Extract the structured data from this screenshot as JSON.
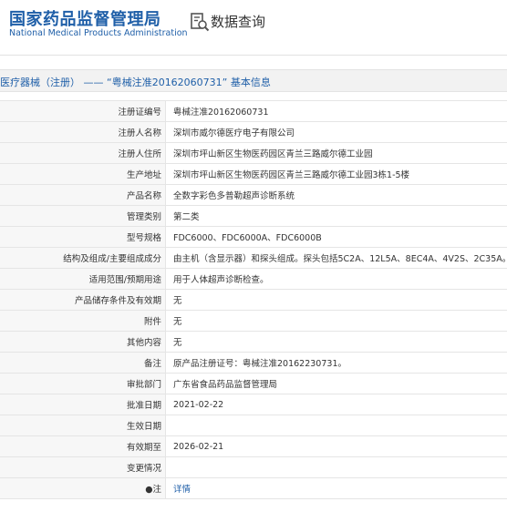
{
  "header": {
    "logo_title": "国家药品监督管理局",
    "logo_subtitle": "National Medical Products Administration",
    "query_icon": "search-document-icon",
    "query_title": "数据查询"
  },
  "section": {
    "title": "医疗器械（注册） —— “粤械注准20162060731” 基本信息"
  },
  "rows": [
    {
      "label": "注册证编号",
      "value": "粤械注准20162060731"
    },
    {
      "label": "注册人名称",
      "value": "深圳市威尔德医疗电子有限公司"
    },
    {
      "label": "注册人住所",
      "value": "深圳市坪山新区生物医药园区青兰三路威尔德工业园"
    },
    {
      "label": "生产地址",
      "value": "深圳市坪山新区生物医药园区青兰三路威尔德工业园3栋1-5楼"
    },
    {
      "label": "产品名称",
      "value": "全数字彩色多普勒超声诊断系统"
    },
    {
      "label": "管理类别",
      "value": "第二类"
    },
    {
      "label": "型号规格",
      "value": "FDC6000、FDC6000A、FDC6000B"
    },
    {
      "label": "结构及组成/主要组成成分",
      "value": "由主机（含显示器）和探头组成。探头包括5C2A、12L5A、8EC4A、4V2S、2C35A。"
    },
    {
      "label": "适用范围/预期用途",
      "value": "用于人体超声诊断检查。"
    },
    {
      "label": "产品储存条件及有效期",
      "value": "无"
    },
    {
      "label": "附件",
      "value": "无"
    },
    {
      "label": "其他内容",
      "value": "无"
    },
    {
      "label": "备注",
      "value": "原产品注册证号：粤械注准20162230731。"
    },
    {
      "label": "审批部门",
      "value": "广东省食品药品监督管理局"
    },
    {
      "label": "批准日期",
      "value": "2021-02-22"
    },
    {
      "label": "生效日期",
      "value": ""
    },
    {
      "label": "有效期至",
      "value": "2026-02-21"
    },
    {
      "label": "变更情况",
      "value": ""
    },
    {
      "label": "●注",
      "value": "详情"
    }
  ],
  "colors": {
    "brand_blue": "#1f5fa8",
    "label_bg": "#f7f7f7",
    "section_bg": "#f2f2f2"
  }
}
